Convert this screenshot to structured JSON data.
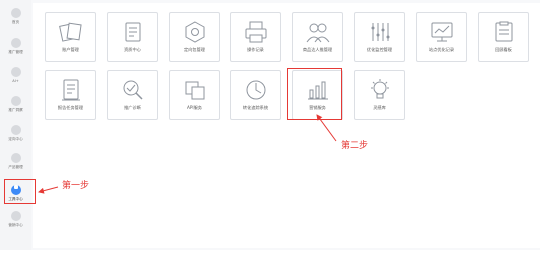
{
  "sidebar": {
    "items": [
      {
        "label": "首页",
        "icon": "home-icon"
      },
      {
        "label": "推广管理",
        "icon": "promotion-icon"
      },
      {
        "label": "AI+",
        "icon": "ai-icon"
      },
      {
        "label": "推广洞察",
        "icon": "insight-icon"
      },
      {
        "label": "定向中心",
        "icon": "target-icon"
      },
      {
        "label": "产品管理",
        "icon": "product-icon"
      },
      {
        "label": "工具中心",
        "icon": "tools-icon"
      },
      {
        "label": "营销中心",
        "icon": "marketing-icon"
      }
    ],
    "active_index": 6
  },
  "tools": {
    "row1": [
      {
        "label": "账户管理",
        "icon": "document-stack-icon"
      },
      {
        "label": "资质中心",
        "icon": "qualification-icon"
      },
      {
        "label": "定向包管理",
        "icon": "target-package-icon"
      },
      {
        "label": "操作记录",
        "icon": "printer-icon"
      },
      {
        "label": "商品达人推管理",
        "icon": "people-icon"
      },
      {
        "label": "优化监控管理",
        "icon": "monitor-icon"
      },
      {
        "label": "站点优化记录",
        "icon": "chart-screen-icon"
      },
      {
        "label": "回顾看板",
        "icon": "review-board-icon"
      }
    ],
    "row2": [
      {
        "label": "报告任务管理",
        "icon": "report-icon"
      },
      {
        "label": "推广诊断",
        "icon": "diagnosis-icon"
      },
      {
        "label": "API服务",
        "icon": "api-copy-icon"
      },
      {
        "label": "转化追踪系统",
        "icon": "conversion-icon"
      },
      {
        "label": "营销服务",
        "icon": "marketing-service-icon"
      },
      {
        "label": "灵感库",
        "icon": "lightbulb-icon"
      }
    ]
  },
  "annotations": {
    "step1": "第一步",
    "step2": "第二步"
  },
  "colors": {
    "accent": "#3d8af7",
    "highlight": "#e53935"
  }
}
